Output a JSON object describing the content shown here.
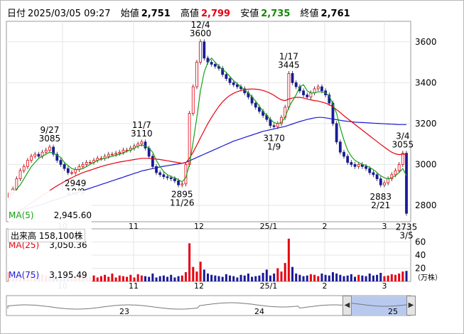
{
  "header": {
    "date_label": "日付",
    "datetime": "2025/03/05 09:27",
    "open_label": "始値",
    "open": "2,751",
    "high_label": "高値",
    "high": "2,799",
    "low_label": "安値",
    "low": "2,735",
    "close_label": "終値",
    "close": "2,761"
  },
  "legend": {
    "ma5_label": "MA(5)",
    "ma5_value": "2,945.60",
    "ma25_label": "MA(25)",
    "ma25_value": "3,050.36",
    "ma75_label": "MA(75)",
    "ma75_value": "3,195.49"
  },
  "volume_label": "出来高  158,100株",
  "volume_unit": "（万株）",
  "colors": {
    "up": "#e60012",
    "down": "#1a1a99",
    "ma5": "#13a313",
    "ma25": "#e60012",
    "ma75": "#1a1ad0",
    "grid": "#e6e6e6",
    "nav_fill": "#b8c9ef"
  },
  "chart_data": {
    "type": "candlestick",
    "y_axis": {
      "ticks": [
        2800,
        3000,
        3200,
        3400,
        3600
      ],
      "range": [
        2720,
        3700
      ]
    },
    "x_axis": {
      "labels": [
        "10",
        "11",
        "12",
        "25/1",
        "2",
        "3"
      ]
    },
    "annotations": [
      {
        "lines": [
          "12/4",
          "3600"
        ],
        "price": 3600,
        "place": "above"
      },
      {
        "lines": [
          "1/17",
          "3445"
        ],
        "price": 3445,
        "place": "above"
      },
      {
        "lines": [
          "9/27",
          "3085"
        ],
        "price": 3085,
        "place": "above"
      },
      {
        "lines": [
          "11/7",
          "3110"
        ],
        "price": 3110,
        "place": "above"
      },
      {
        "lines": [
          "2949",
          "10/9"
        ],
        "price": 2949,
        "place": "below"
      },
      {
        "lines": [
          "2895",
          "11/26"
        ],
        "price": 2895,
        "place": "below"
      },
      {
        "lines": [
          "3170",
          "1/9"
        ],
        "price": 3170,
        "place": "below"
      },
      {
        "lines": [
          "3/4",
          "3055"
        ],
        "price": 3055,
        "place": "above"
      },
      {
        "lines": [
          "2883",
          "2/21"
        ],
        "price": 2883,
        "place": "below"
      },
      {
        "lines": [
          "2735",
          "3/5"
        ],
        "price": 2735,
        "place": "below"
      }
    ],
    "closes": [
      2860,
      2880,
      2930,
      2970,
      2990,
      3020,
      3040,
      3050,
      3040,
      3060,
      3070,
      3085,
      3050,
      3020,
      3000,
      2980,
      2960,
      2960,
      2975,
      2990,
      3000,
      3010,
      3010,
      3020,
      3030,
      3030,
      3040,
      3050,
      3050,
      3055,
      3060,
      3070,
      3070,
      3080,
      3090,
      3100,
      3110,
      3080,
      3040,
      2990,
      2960,
      2950,
      2940,
      2935,
      2930,
      2920,
      2900,
      2905,
      3000,
      3250,
      3380,
      3500,
      3600,
      3520,
      3500,
      3490,
      3480,
      3470,
      3440,
      3420,
      3400,
      3390,
      3380,
      3370,
      3350,
      3330,
      3300,
      3280,
      3260,
      3240,
      3220,
      3190,
      3185,
      3200,
      3230,
      3280,
      3445,
      3400,
      3380,
      3360,
      3340,
      3330,
      3350,
      3370,
      3380,
      3360,
      3340,
      3300,
      3200,
      3110,
      3060,
      3040,
      3010,
      3000,
      2990,
      3000,
      2990,
      2980,
      2960,
      2950,
      2930,
      2900,
      2910,
      2930,
      2950,
      2970,
      3000,
      3055,
      2761
    ],
    "ma5": [
      2850,
      2860,
      2880,
      2900,
      2930,
      2960,
      2990,
      3010,
      3030,
      3040,
      3050,
      3060,
      3055,
      3045,
      3035,
      3010,
      2995,
      2980,
      2975,
      2975,
      2980,
      2990,
      3000,
      3010,
      3020,
      3025,
      3030,
      3035,
      3040,
      3045,
      3050,
      3055,
      3065,
      3070,
      3080,
      3090,
      3095,
      3090,
      3080,
      3060,
      3020,
      2990,
      2965,
      2950,
      2940,
      2935,
      2925,
      2915,
      2935,
      3000,
      3110,
      3230,
      3360,
      3450,
      3500,
      3520,
      3500,
      3480,
      3465,
      3450,
      3430,
      3410,
      3395,
      3380,
      3365,
      3350,
      3330,
      3310,
      3285,
      3260,
      3240,
      3220,
      3205,
      3200,
      3205,
      3230,
      3280,
      3310,
      3340,
      3380,
      3390,
      3360,
      3350,
      3350,
      3355,
      3355,
      3350,
      3335,
      3295,
      3250,
      3180,
      3120,
      3070,
      3040,
      3020,
      3010,
      3000,
      2995,
      2985,
      2975,
      2960,
      2945,
      2935,
      2930,
      2935,
      2945,
      2960,
      2980,
      2945
    ],
    "ma25": [
      2740,
      2752,
      2764,
      2776,
      2788,
      2800,
      2812,
      2824,
      2836,
      2848,
      2860,
      2872,
      2884,
      2896,
      2906,
      2916,
      2926,
      2935,
      2944,
      2952,
      2960,
      2966,
      2972,
      2978,
      2984,
      2990,
      2995,
      3000,
      3004,
      3008,
      3012,
      3015,
      3018,
      3021,
      3024,
      3027,
      3030,
      3030,
      3030,
      3028,
      3026,
      3024,
      3021,
      3018,
      3015,
      3012,
      3009,
      3006,
      3008,
      3030,
      3060,
      3095,
      3130,
      3165,
      3200,
      3230,
      3258,
      3284,
      3306,
      3324,
      3338,
      3348,
      3356,
      3362,
      3366,
      3368,
      3369,
      3368,
      3366,
      3362,
      3356,
      3348,
      3338,
      3326,
      3316,
      3312,
      3320,
      3325,
      3328,
      3328,
      3325,
      3320,
      3316,
      3312,
      3310,
      3305,
      3300,
      3292,
      3282,
      3268,
      3254,
      3238,
      3224,
      3210,
      3196,
      3182,
      3168,
      3154,
      3140,
      3126,
      3112,
      3098,
      3085,
      3072,
      3060,
      3052,
      3048,
      3050,
      3050
    ],
    "ma75": [
      2760,
      2765,
      2770,
      2775,
      2780,
      2785,
      2790,
      2795,
      2800,
      2806,
      2812,
      2818,
      2824,
      2830,
      2836,
      2842,
      2848,
      2854,
      2860,
      2866,
      2872,
      2878,
      2884,
      2890,
      2896,
      2902,
      2908,
      2914,
      2920,
      2926,
      2932,
      2938,
      2944,
      2950,
      2956,
      2962,
      2968,
      2972,
      2976,
      2980,
      2984,
      2988,
      2991,
      2994,
      2997,
      3000,
      3003,
      3006,
      3010,
      3018,
      3026,
      3034,
      3042,
      3050,
      3058,
      3066,
      3074,
      3082,
      3090,
      3098,
      3106,
      3114,
      3120,
      3126,
      3132,
      3138,
      3144,
      3150,
      3156,
      3162,
      3166,
      3170,
      3174,
      3178,
      3182,
      3186,
      3192,
      3198,
      3204,
      3210,
      3215,
      3220,
      3224,
      3228,
      3230,
      3230,
      3228,
      3225,
      3222,
      3219,
      3216,
      3213,
      3211,
      3209,
      3207,
      3206,
      3205,
      3204,
      3203,
      3202,
      3201,
      3200,
      3199,
      3198,
      3197,
      3196,
      3195,
      3195,
      3195
    ],
    "volumes": [
      14,
      6,
      8,
      10,
      5,
      9,
      12,
      7,
      6,
      11,
      9,
      8,
      13,
      6,
      5,
      10,
      7,
      8,
      9,
      6,
      11,
      8,
      7,
      9,
      6,
      8,
      10,
      7,
      12,
      6,
      9,
      8,
      7,
      10,
      6,
      11,
      9,
      8,
      7,
      12,
      6,
      8,
      9,
      7,
      10,
      6,
      8,
      9,
      14,
      58,
      22,
      15,
      30,
      18,
      12,
      10,
      9,
      8,
      7,
      11,
      9,
      8,
      6,
      10,
      9,
      12,
      7,
      8,
      9,
      13,
      18,
      9,
      12,
      20,
      15,
      28,
      65,
      22,
      12,
      10,
      8,
      9,
      11,
      10,
      8,
      12,
      10,
      9,
      14,
      12,
      10,
      8,
      9,
      11,
      7,
      10,
      9,
      8,
      12,
      9,
      10,
      13,
      8,
      9,
      11,
      10,
      12,
      15,
      16
    ],
    "volume_axis": {
      "ticks": [
        20,
        40,
        60
      ],
      "range": [
        0,
        80
      ]
    },
    "navigator": {
      "labels": [
        "23",
        "24",
        "25"
      ]
    }
  }
}
